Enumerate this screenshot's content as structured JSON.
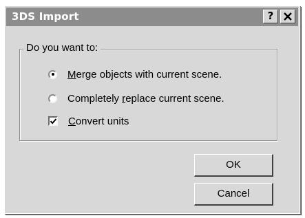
{
  "dialog": {
    "title": "3DS Import",
    "help_button": "?",
    "close_button": "✕"
  },
  "group": {
    "legend": "Do you want to:"
  },
  "options": {
    "merge": {
      "access_key": "M",
      "rest": "erge objects with current scene.",
      "selected": true
    },
    "replace": {
      "before": "Completely ",
      "access_key": "r",
      "rest": "eplace current scene.",
      "selected": false
    },
    "convert": {
      "access_key": "C",
      "rest": "onvert units",
      "checked": true
    }
  },
  "buttons": {
    "ok": "OK",
    "cancel": "Cancel"
  }
}
